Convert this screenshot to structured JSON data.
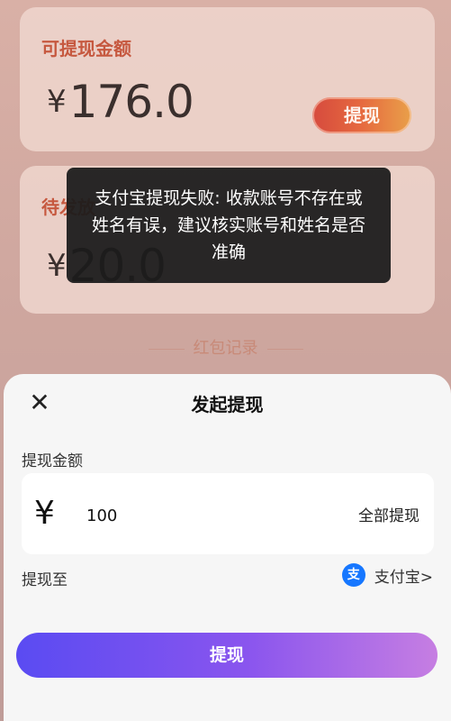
{
  "background": {
    "card1": {
      "title": "可提现金额",
      "currency": "¥",
      "amount": "176.0",
      "button_label": "提现"
    },
    "card2": {
      "title": "待发放",
      "currency": "¥",
      "amount": "20.0"
    },
    "record_link": "红包记录"
  },
  "toast": {
    "message": "支付宝提现失败: 收款账号不存在或姓名有误，建议核实账号和姓名是否准确"
  },
  "sheet": {
    "close_icon": "close-icon",
    "title": "发起提现",
    "amount_label": "提现金额",
    "currency_symbol": "¥",
    "amount_value": "100",
    "withdraw_all_label": "全部提现",
    "destination_label": "提现至",
    "destination": {
      "icon": "alipay-icon",
      "icon_glyph": "支",
      "label": "支付宝>"
    },
    "submit_label": "提现"
  },
  "colors": {
    "accent_red": "#c6583f",
    "submit_gradient_start": "#5a4bf2",
    "submit_gradient_end": "#c67ee2",
    "alipay_blue": "#1677ff"
  }
}
